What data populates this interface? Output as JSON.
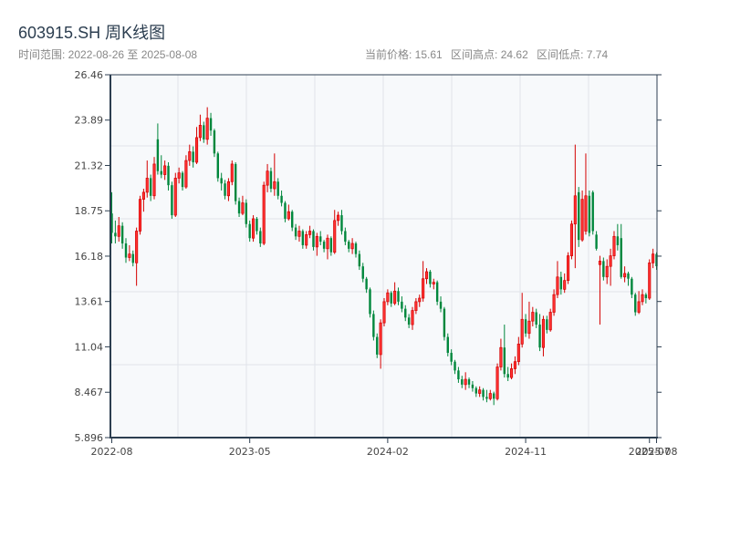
{
  "header": {
    "title": "603915.SH 周K线图",
    "range_label": "时间范围: 2022-08-26 至 2025-08-08",
    "current_price": "当前价格: 15.61",
    "range_high": "区间高点: 24.62",
    "range_low": "区间低点: 7.74"
  },
  "colors": {
    "up": "#d40000",
    "up_fill": "#ff3333",
    "down": "#00873c",
    "axis": "#2c3e50",
    "plot_bg": "#f7f9fb",
    "grid": "#e1e4ea"
  },
  "chart_data": {
    "type": "candlestick",
    "title": "603915.SH 周K线图",
    "ylim": [
      5.896,
      26.46
    ],
    "grid": true,
    "yticks": [
      "5.896",
      "8.467",
      "11.04",
      "13.61",
      "16.18",
      "18.75",
      "21.32",
      "23.89",
      "26.46"
    ],
    "xticks": [
      {
        "date": "2022-08-26",
        "label": "2022-08"
      },
      {
        "date": "2023-05-26",
        "label": "2023-05"
      },
      {
        "date": "2024-02-23",
        "label": "2024-02"
      },
      {
        "date": "2024-11-22",
        "label": "2024-11"
      },
      {
        "date": "2025-07-25",
        "label": "2025-07"
      },
      {
        "date": "2025-08-08",
        "label": "2025-08"
      }
    ],
    "columns": [
      "date",
      "open",
      "high",
      "low",
      "close"
    ],
    "candles": [
      [
        "2022-08-26",
        18.6,
        19.8,
        16.9,
        17.5
      ],
      [
        "2022-09-02",
        17.5,
        18.2,
        16.9,
        17.3
      ],
      [
        "2022-09-09",
        17.3,
        18.4,
        17.0,
        17.9
      ],
      [
        "2022-09-16",
        17.9,
        18.1,
        16.6,
        16.9
      ],
      [
        "2022-09-23",
        16.9,
        17.2,
        15.8,
        16.1
      ],
      [
        "2022-09-30",
        16.1,
        16.8,
        15.9,
        16.3
      ],
      [
        "2022-10-07",
        16.3,
        16.5,
        15.6,
        15.8
      ],
      [
        "2022-10-14",
        15.8,
        17.8,
        14.5,
        17.6
      ],
      [
        "2022-10-21",
        17.6,
        19.6,
        17.4,
        19.4
      ],
      [
        "2022-10-28",
        19.4,
        20.0,
        18.7,
        19.8
      ],
      [
        "2022-11-04",
        19.8,
        21.6,
        19.5,
        20.6
      ],
      [
        "2022-11-11",
        20.6,
        20.8,
        19.3,
        19.6
      ],
      [
        "2022-11-18",
        19.6,
        21.8,
        19.4,
        21.4
      ],
      [
        "2022-11-25",
        22.8,
        23.7,
        20.8,
        21.0
      ],
      [
        "2022-12-02",
        21.0,
        21.9,
        20.6,
        20.8
      ],
      [
        "2022-12-09",
        20.8,
        21.6,
        20.5,
        21.3
      ],
      [
        "2022-12-16",
        21.3,
        21.5,
        19.9,
        20.2
      ],
      [
        "2022-12-23",
        20.2,
        20.4,
        18.3,
        18.5
      ],
      [
        "2022-12-30",
        18.5,
        20.9,
        18.4,
        20.6
      ],
      [
        "2023-01-06",
        20.6,
        21.2,
        20.3,
        20.9
      ],
      [
        "2023-01-13",
        20.9,
        21.0,
        19.9,
        20.1
      ],
      [
        "2023-01-20",
        20.1,
        21.9,
        20.0,
        21.6
      ],
      [
        "2023-01-27",
        21.6,
        22.5,
        21.3,
        22.1
      ],
      [
        "2023-02-03",
        22.1,
        22.4,
        21.2,
        21.5
      ],
      [
        "2023-02-10",
        21.5,
        23.5,
        21.4,
        22.9
      ],
      [
        "2023-02-17",
        22.9,
        24.2,
        22.7,
        23.6
      ],
      [
        "2023-02-24",
        23.6,
        23.8,
        22.6,
        22.8
      ],
      [
        "2023-03-03",
        22.8,
        24.62,
        22.5,
        24.0
      ],
      [
        "2023-03-10",
        24.0,
        24.3,
        23.0,
        23.3
      ],
      [
        "2023-03-17",
        23.3,
        23.4,
        21.8,
        22.0
      ],
      [
        "2023-03-24",
        22.0,
        22.1,
        20.4,
        20.6
      ],
      [
        "2023-03-31",
        20.6,
        20.9,
        19.9,
        20.3
      ],
      [
        "2023-04-07",
        20.3,
        20.5,
        19.4,
        19.6
      ],
      [
        "2023-04-14",
        19.6,
        20.6,
        19.3,
        20.4
      ],
      [
        "2023-04-21",
        20.4,
        21.6,
        20.2,
        21.4
      ],
      [
        "2023-04-28",
        21.4,
        21.5,
        19.1,
        19.3
      ],
      [
        "2023-05-05",
        19.3,
        19.5,
        18.4,
        18.6
      ],
      [
        "2023-05-12",
        18.6,
        19.6,
        18.5,
        19.2
      ],
      [
        "2023-05-19",
        19.2,
        19.4,
        17.8,
        18.0
      ],
      [
        "2023-05-26",
        18.0,
        18.2,
        17.0,
        17.2
      ],
      [
        "2023-06-02",
        17.2,
        18.5,
        17.0,
        18.3
      ],
      [
        "2023-06-09",
        18.3,
        18.4,
        17.4,
        17.6
      ],
      [
        "2023-06-16",
        17.6,
        17.8,
        16.7,
        16.9
      ],
      [
        "2023-06-23",
        16.9,
        20.4,
        16.8,
        20.2
      ],
      [
        "2023-06-30",
        20.2,
        21.4,
        19.8,
        21.0
      ],
      [
        "2023-07-07",
        21.0,
        21.2,
        19.8,
        20.0
      ],
      [
        "2023-07-14",
        20.0,
        22.0,
        19.6,
        20.4
      ],
      [
        "2023-07-21",
        20.4,
        20.6,
        19.4,
        19.6
      ],
      [
        "2023-07-28",
        19.6,
        19.9,
        19.0,
        19.2
      ],
      [
        "2023-08-04",
        19.2,
        19.3,
        18.1,
        18.3
      ],
      [
        "2023-08-11",
        18.3,
        19.1,
        18.2,
        18.7
      ],
      [
        "2023-08-18",
        18.7,
        18.8,
        17.6,
        17.8
      ],
      [
        "2023-08-25",
        17.8,
        18.0,
        17.1,
        17.3
      ],
      [
        "2023-09-01",
        17.3,
        17.9,
        17.0,
        17.6
      ],
      [
        "2023-09-08",
        17.6,
        17.7,
        16.6,
        16.8
      ],
      [
        "2023-09-15",
        16.8,
        17.6,
        16.6,
        17.4
      ],
      [
        "2023-09-22",
        17.4,
        17.9,
        17.2,
        17.6
      ],
      [
        "2023-09-29",
        17.6,
        17.7,
        16.5,
        16.7
      ],
      [
        "2023-10-06",
        16.7,
        17.5,
        16.2,
        17.3
      ],
      [
        "2023-10-13",
        17.3,
        17.6,
        16.8,
        17.0
      ],
      [
        "2023-10-20",
        17.0,
        17.1,
        16.4,
        16.6
      ],
      [
        "2023-10-27",
        16.6,
        17.4,
        16.0,
        17.2
      ],
      [
        "2023-11-03",
        17.2,
        17.3,
        16.2,
        16.4
      ],
      [
        "2023-11-10",
        16.4,
        18.8,
        16.3,
        18.2
      ],
      [
        "2023-11-17",
        18.2,
        18.7,
        17.9,
        18.5
      ],
      [
        "2023-11-24",
        18.5,
        18.8,
        17.4,
        17.6
      ],
      [
        "2023-12-01",
        17.6,
        17.8,
        16.8,
        17.0
      ],
      [
        "2023-12-08",
        17.0,
        17.1,
        16.4,
        16.6
      ],
      [
        "2023-12-15",
        16.6,
        17.2,
        16.3,
        16.9
      ],
      [
        "2023-12-22",
        16.9,
        17.0,
        16.1,
        16.3
      ],
      [
        "2023-12-29",
        16.3,
        16.5,
        15.4,
        15.6
      ],
      [
        "2024-01-05",
        15.6,
        15.8,
        14.7,
        14.9
      ],
      [
        "2024-01-12",
        14.9,
        15.0,
        14.1,
        14.3
      ],
      [
        "2024-01-19",
        14.3,
        14.4,
        12.7,
        12.9
      ],
      [
        "2024-01-26",
        12.9,
        13.1,
        11.4,
        11.6
      ],
      [
        "2024-02-02",
        11.6,
        11.8,
        10.4,
        10.6
      ],
      [
        "2024-02-09",
        10.6,
        12.6,
        9.8,
        12.4
      ],
      [
        "2024-02-16",
        12.4,
        13.8,
        12.2,
        13.6
      ],
      [
        "2024-02-23",
        13.6,
        14.3,
        13.4,
        14.1
      ],
      [
        "2024-03-01",
        14.1,
        14.2,
        13.3,
        13.5
      ],
      [
        "2024-03-08",
        13.5,
        14.7,
        13.4,
        14.2
      ],
      [
        "2024-03-15",
        14.2,
        14.4,
        13.4,
        13.6
      ],
      [
        "2024-03-22",
        13.6,
        13.9,
        13.0,
        13.2
      ],
      [
        "2024-03-29",
        13.2,
        13.4,
        12.5,
        12.7
      ],
      [
        "2024-04-05",
        12.7,
        12.9,
        12.1,
        12.3
      ],
      [
        "2024-04-12",
        12.3,
        13.3,
        12.0,
        13.1
      ],
      [
        "2024-04-19",
        13.1,
        13.8,
        12.9,
        13.6
      ],
      [
        "2024-04-26",
        13.6,
        14.0,
        13.3,
        13.8
      ],
      [
        "2024-05-03",
        13.8,
        15.9,
        13.6,
        14.9
      ],
      [
        "2024-05-10",
        14.9,
        15.5,
        14.6,
        15.3
      ],
      [
        "2024-05-17",
        15.3,
        15.4,
        14.4,
        14.6
      ],
      [
        "2024-05-24",
        14.6,
        14.9,
        14.3,
        14.7
      ],
      [
        "2024-05-31",
        14.7,
        14.8,
        13.4,
        13.6
      ],
      [
        "2024-06-07",
        13.6,
        13.9,
        13.0,
        13.2
      ],
      [
        "2024-06-14",
        13.2,
        13.3,
        11.4,
        11.6
      ],
      [
        "2024-06-21",
        11.6,
        11.8,
        10.5,
        10.7
      ],
      [
        "2024-06-28",
        10.7,
        10.9,
        10.0,
        10.2
      ],
      [
        "2024-07-05",
        10.2,
        10.3,
        9.5,
        9.7
      ],
      [
        "2024-07-12",
        9.7,
        9.9,
        9.0,
        9.2
      ],
      [
        "2024-07-19",
        9.2,
        9.4,
        8.7,
        8.9
      ],
      [
        "2024-07-26",
        8.9,
        9.6,
        8.6,
        9.2
      ],
      [
        "2024-08-02",
        9.2,
        9.3,
        8.7,
        8.9
      ],
      [
        "2024-08-09",
        8.9,
        9.1,
        8.5,
        8.7
      ],
      [
        "2024-08-16",
        8.7,
        8.8,
        8.2,
        8.4
      ],
      [
        "2024-08-23",
        8.4,
        8.8,
        8.2,
        8.6
      ],
      [
        "2024-08-30",
        8.6,
        8.7,
        8.0,
        8.2
      ],
      [
        "2024-09-06",
        8.2,
        8.6,
        7.9,
        8.1
      ],
      [
        "2024-09-13",
        8.1,
        8.6,
        8.0,
        8.4
      ],
      [
        "2024-09-20",
        8.4,
        8.5,
        7.74,
        8.1
      ],
      [
        "2024-09-27",
        8.1,
        10.1,
        8.0,
        9.9
      ],
      [
        "2024-10-04",
        9.9,
        11.5,
        9.7,
        11.0
      ],
      [
        "2024-10-11",
        11.0,
        12.3,
        9.3,
        9.5
      ],
      [
        "2024-10-18",
        9.5,
        9.9,
        9.1,
        9.3
      ],
      [
        "2024-10-25",
        9.3,
        10.1,
        9.2,
        9.8
      ],
      [
        "2024-11-01",
        9.8,
        10.5,
        9.5,
        10.2
      ],
      [
        "2024-11-08",
        10.2,
        11.6,
        10.0,
        11.2
      ],
      [
        "2024-11-15",
        11.2,
        14.1,
        11.0,
        12.6
      ],
      [
        "2024-11-22",
        12.6,
        12.9,
        11.6,
        11.8
      ],
      [
        "2024-11-29",
        11.8,
        13.6,
        11.5,
        12.5
      ],
      [
        "2024-12-06",
        12.5,
        13.3,
        12.2,
        13.0
      ],
      [
        "2024-12-13",
        13.0,
        13.2,
        12.1,
        12.3
      ],
      [
        "2024-12-20",
        12.3,
        12.9,
        10.8,
        11.0
      ],
      [
        "2024-12-27",
        11.0,
        12.8,
        10.5,
        12.6
      ],
      [
        "2025-01-03",
        12.6,
        12.8,
        11.8,
        12.0
      ],
      [
        "2025-01-10",
        12.0,
        13.2,
        11.9,
        13.0
      ],
      [
        "2025-01-17",
        13.0,
        14.3,
        12.8,
        14.0
      ],
      [
        "2025-01-24",
        14.0,
        15.9,
        13.8,
        15.0
      ],
      [
        "2025-01-31",
        15.0,
        15.3,
        14.0,
        14.3
      ],
      [
        "2025-02-07",
        14.3,
        15.2,
        14.1,
        14.8
      ],
      [
        "2025-02-14",
        14.8,
        16.4,
        14.6,
        16.2
      ],
      [
        "2025-02-21",
        16.2,
        18.2,
        16.0,
        18.0
      ],
      [
        "2025-02-28",
        18.0,
        22.5,
        15.5,
        19.6
      ],
      [
        "2025-03-07",
        19.8,
        20.1,
        16.7,
        17.1
      ],
      [
        "2025-03-14",
        17.1,
        19.9,
        17.0,
        19.4
      ],
      [
        "2025-03-21",
        17.6,
        22.0,
        17.4,
        19.6
      ],
      [
        "2025-03-28",
        19.6,
        19.9,
        17.3,
        17.5
      ],
      [
        "2025-04-04",
        19.8,
        19.9,
        17.4,
        17.6
      ],
      [
        "2025-04-11",
        17.4,
        17.6,
        16.5,
        16.6
      ],
      [
        "2025-04-18",
        15.7,
        16.2,
        12.3,
        15.9
      ],
      [
        "2025-04-25",
        15.9,
        16.1,
        14.8,
        15.0
      ],
      [
        "2025-05-02",
        15.0,
        16.0,
        14.6,
        15.6
      ],
      [
        "2025-05-09",
        15.6,
        16.6,
        14.5,
        16.2
      ],
      [
        "2025-05-16",
        16.2,
        17.6,
        16.0,
        17.3
      ],
      [
        "2025-05-23",
        17.3,
        18.0,
        16.5,
        16.8
      ],
      [
        "2025-05-30",
        17.2,
        18.0,
        14.9,
        15.0
      ],
      [
        "2025-06-06",
        15.0,
        15.6,
        14.7,
        15.2
      ],
      [
        "2025-06-13",
        15.2,
        15.3,
        14.5,
        14.9
      ],
      [
        "2025-06-20",
        14.9,
        15.0,
        13.8,
        14.0
      ],
      [
        "2025-06-27",
        14.0,
        14.1,
        12.8,
        13.0
      ],
      [
        "2025-07-04",
        13.0,
        14.2,
        12.9,
        13.6
      ],
      [
        "2025-07-11",
        13.6,
        14.3,
        13.4,
        14.0
      ],
      [
        "2025-07-18",
        14.0,
        14.1,
        13.5,
        13.8
      ],
      [
        "2025-07-25",
        13.8,
        16.0,
        13.7,
        15.8
      ],
      [
        "2025-08-01",
        15.8,
        16.6,
        15.5,
        16.3
      ],
      [
        "2025-08-08",
        16.3,
        16.4,
        15.4,
        15.61
      ]
    ]
  }
}
